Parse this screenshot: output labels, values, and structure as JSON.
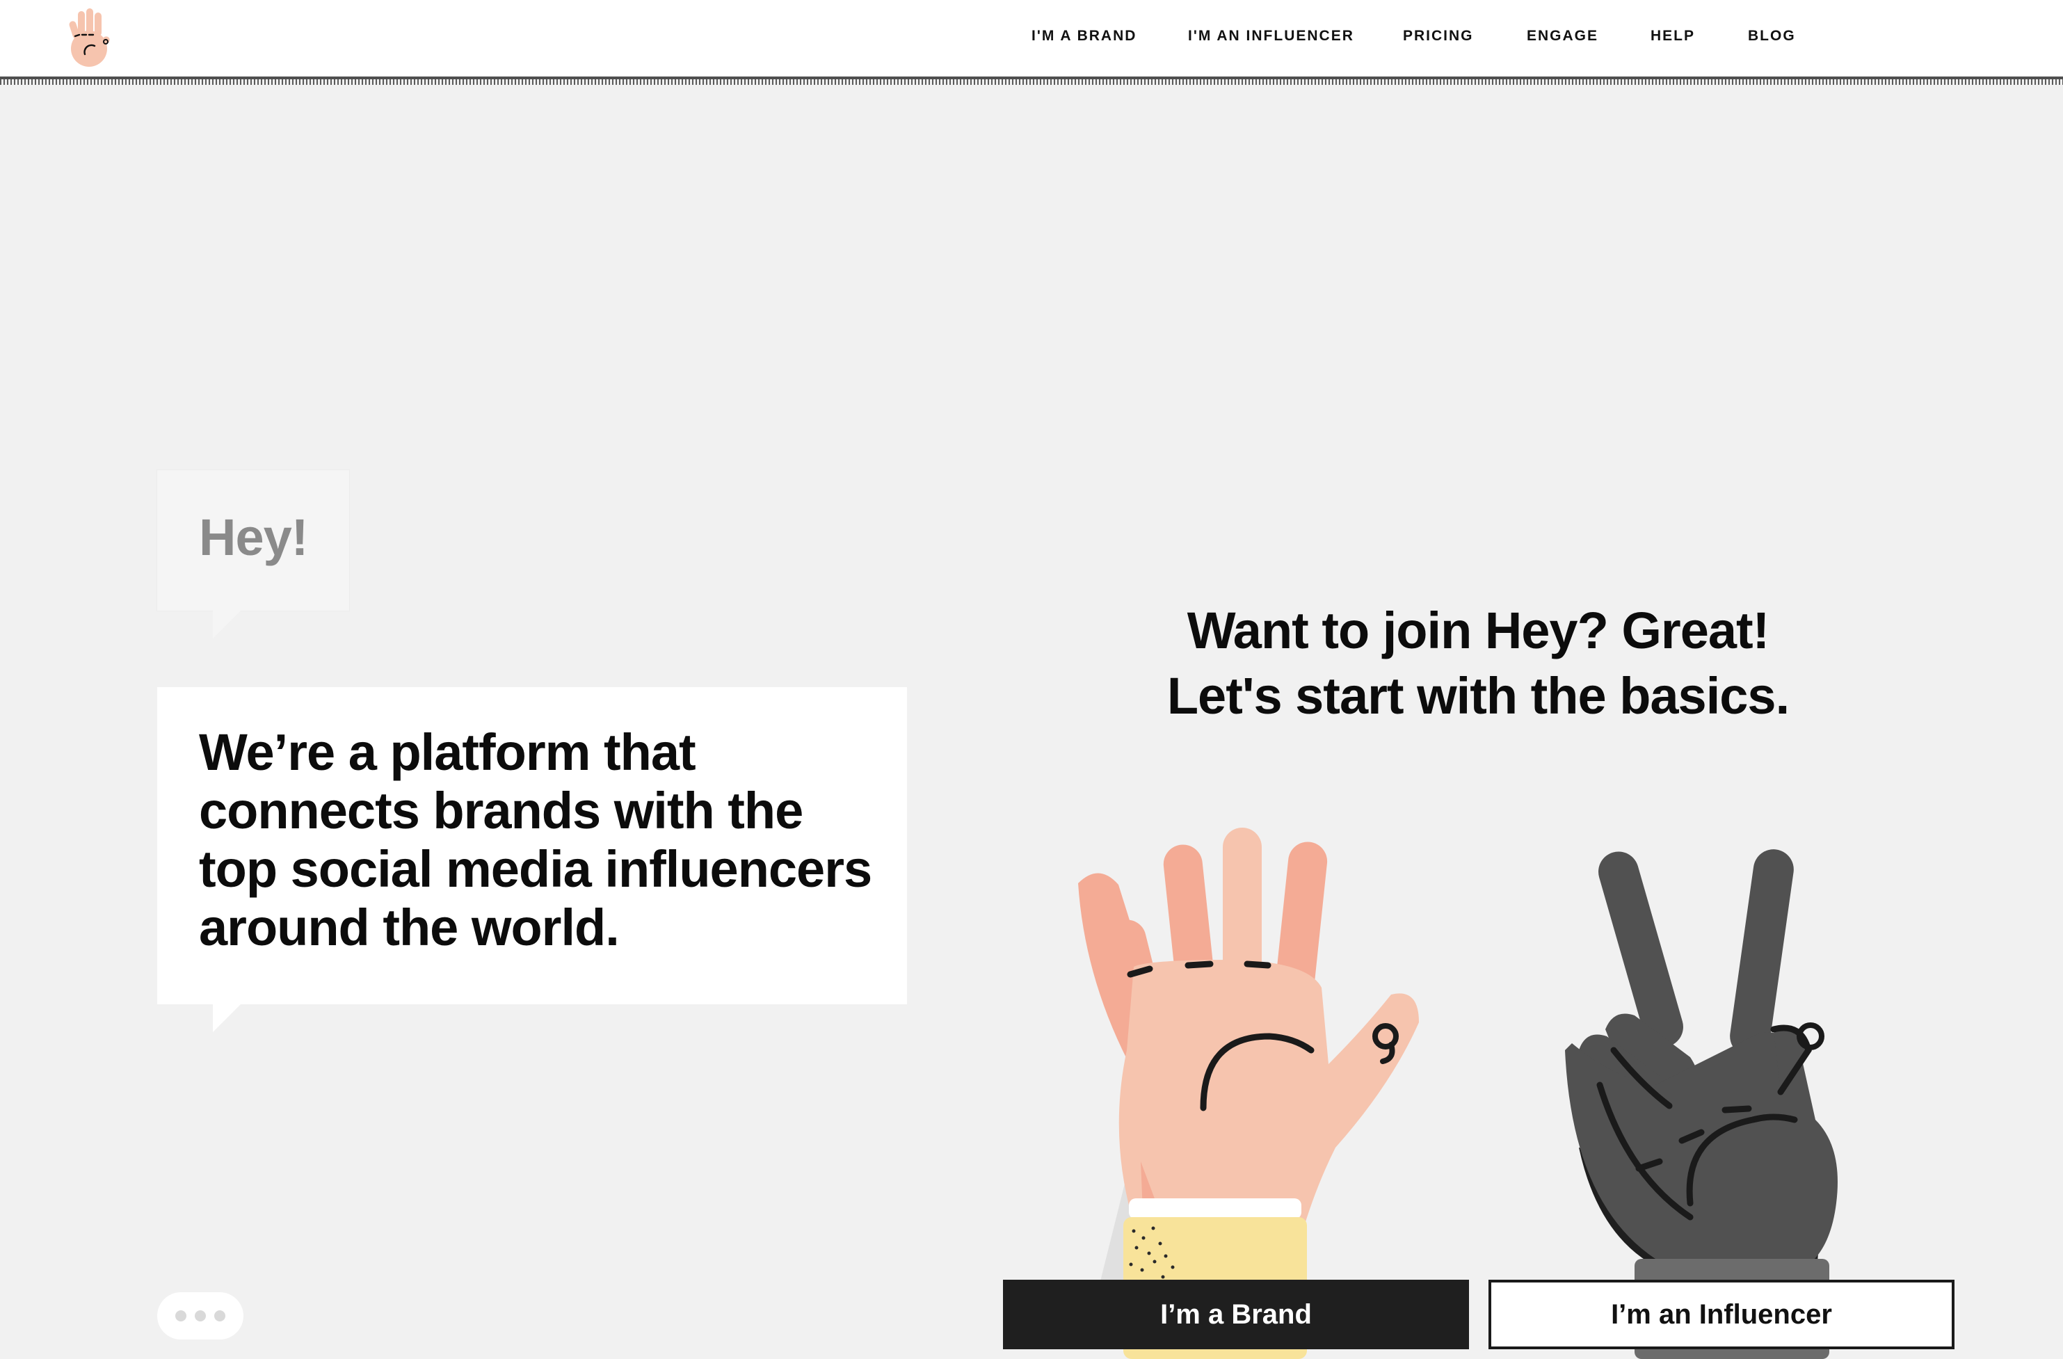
{
  "brand": {
    "logo_icon": "waving-hand-icon",
    "logo_color": "#f6c4ae"
  },
  "nav": {
    "brand": "I'M A BRAND",
    "influencer": "I'M AN INFLUENCER",
    "pricing": "PRICING",
    "engage": "ENGAGE",
    "help": "HELP",
    "blog": "BLOG"
  },
  "intro": {
    "greeting": "Hey!",
    "pitch": "We’re a platform that connects brands with the top social media influencers around the world."
  },
  "join": {
    "line1": "Want to join Hey? Great!",
    "line2": "Let's start with the basics."
  },
  "cta": {
    "brand_label": "I’m a Brand",
    "influencer_label": "I’m an Influencer"
  },
  "colors": {
    "background": "#f1f1f1",
    "skin_hand": "#f6c4ae",
    "dark_hand": "#4d4d4d",
    "brand_button": "#1f1f1f",
    "sleeve": "#f8e39a"
  }
}
